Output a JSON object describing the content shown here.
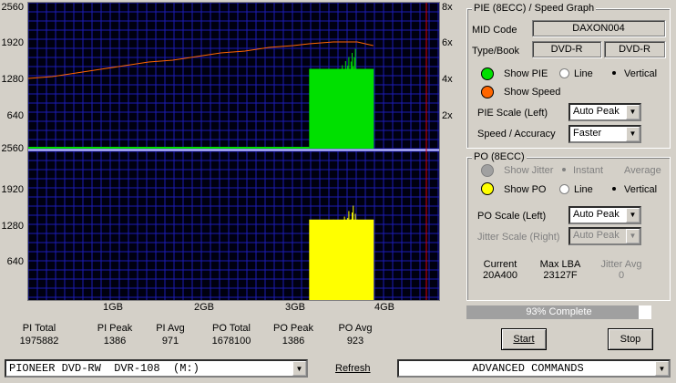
{
  "pie_graph": {
    "y_left": [
      "2560",
      "1920",
      "1280",
      "640"
    ],
    "y_right": [
      "8x",
      "6x",
      "4x",
      "2x"
    ],
    "y_max": 2560,
    "speed_max": 8
  },
  "po_graph": {
    "y_left": [
      "2560",
      "1920",
      "1280",
      "640"
    ],
    "y_max": 2560
  },
  "x_axis": [
    "1GB",
    "2GB",
    "3GB",
    "4GB"
  ],
  "chart_data": [
    {
      "type": "area",
      "series": [
        {
          "values": [
            0,
            0,
            0,
            0,
            0,
            0,
            0,
            0,
            0,
            0,
            0,
            0,
            1400,
            1400,
            1400,
            1400
          ]
        },
        {
          "values": [
            4.0,
            4.1,
            4.3,
            4.5,
            4.7,
            4.9,
            5.0,
            5.2,
            5.4,
            5.5,
            5.7,
            5.8,
            5.9,
            6.0,
            6.0,
            5.8
          ]
        }
      ],
      "x": [
        0.0,
        0.3,
        0.6,
        0.9,
        1.2,
        1.5,
        1.8,
        2.1,
        2.4,
        2.7,
        3.0,
        3.3,
        3.5,
        3.8,
        4.1,
        4.3
      ]
    },
    {
      "type": "area",
      "series": [
        {
          "values": [
            0,
            0,
            0,
            0,
            0,
            0,
            0,
            0,
            0,
            0,
            0,
            0,
            1386,
            1386,
            1386,
            1386
          ]
        }
      ],
      "x": [
        0.0,
        0.3,
        0.6,
        0.9,
        1.2,
        1.5,
        1.8,
        2.1,
        2.4,
        2.7,
        3.0,
        3.3,
        3.5,
        3.8,
        4.1,
        4.3
      ]
    }
  ],
  "stats": [
    {
      "label": "PI Total",
      "value": "1975882"
    },
    {
      "label": "PI Peak",
      "value": "1386"
    },
    {
      "label": "PI Avg",
      "value": "971"
    },
    {
      "label": "PO Total",
      "value": "1678100"
    },
    {
      "label": "PO Peak",
      "value": "1386"
    },
    {
      "label": "PO Avg",
      "value": "923"
    }
  ],
  "pie_panel": {
    "title": "PIE (8ECC) / Speed Graph",
    "mid_label": "MID Code",
    "mid_value": "DAXON004",
    "type_label": "Type/Book",
    "type_value": "DVD-R",
    "book_value": "DVD-R",
    "show_pie": "Show PIE",
    "show_speed": "Show Speed",
    "line": "Line",
    "vertical": "Vertical",
    "pie_scale_label": "PIE Scale (Left)",
    "pie_scale_value": "Auto Peak",
    "speed_label": "Speed / Accuracy",
    "speed_value": "Faster",
    "pie_color": "#00e000",
    "speed_color": "#ff6600"
  },
  "po_panel": {
    "title": "PO (8ECC)",
    "show_jitter": "Show Jitter",
    "instant": "Instant",
    "average": "Average",
    "show_po": "Show PO",
    "line": "Line",
    "vertical": "Vertical",
    "po_scale_label": "PO Scale (Left)",
    "po_scale_value": "Auto Peak",
    "jitter_scale_label": "Jitter Scale (Right)",
    "jitter_scale_value": "Auto Peak",
    "current_label": "Current",
    "current_value": "20A400",
    "maxlba_label": "Max LBA",
    "maxlba_value": "23127F",
    "jitteravg_label": "Jitter Avg",
    "jitteravg_value": "0",
    "po_color": "#ffff00"
  },
  "progress": {
    "text": "93% Complete",
    "fraction": 0.93
  },
  "buttons": {
    "start": "Start",
    "stop": "Stop",
    "refresh": "Refresh"
  },
  "drive": "PIONEER DVD-RW  DVR-108  (M:)",
  "advanced": "ADVANCED COMMANDS"
}
